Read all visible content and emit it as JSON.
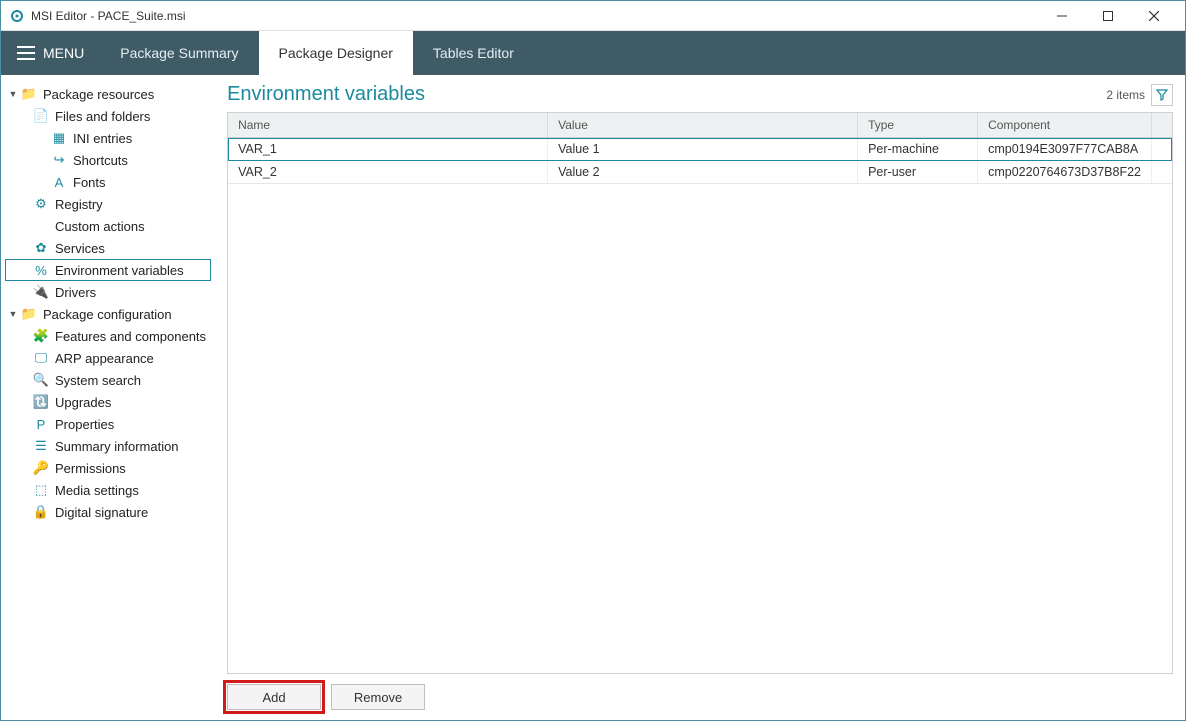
{
  "titlebar": {
    "title": "MSI Editor - PACE_Suite.msi"
  },
  "menubar": {
    "menu_label": "MENU"
  },
  "tabs": [
    {
      "label": "Package Summary",
      "active": false
    },
    {
      "label": "Package Designer",
      "active": true
    },
    {
      "label": "Tables Editor",
      "active": false
    }
  ],
  "sidebar": [
    {
      "label": "Package resources",
      "indent": 0,
      "toggle": "▼",
      "icon": "folder",
      "selected": false
    },
    {
      "label": "Files and folders",
      "indent": 1,
      "icon": "file",
      "selected": false
    },
    {
      "label": "INI entries",
      "indent": 2,
      "icon": "ini",
      "selected": false
    },
    {
      "label": "Shortcuts",
      "indent": 2,
      "icon": "shortcut",
      "selected": false
    },
    {
      "label": "Fonts",
      "indent": 2,
      "icon": "font",
      "selected": false
    },
    {
      "label": "Registry",
      "indent": 1,
      "icon": "registry",
      "selected": false
    },
    {
      "label": "Custom actions",
      "indent": 1,
      "icon": "code",
      "selected": false
    },
    {
      "label": "Services",
      "indent": 1,
      "icon": "gear",
      "selected": false
    },
    {
      "label": "Environment variables",
      "indent": 1,
      "icon": "percent",
      "selected": true
    },
    {
      "label": "Drivers",
      "indent": 1,
      "icon": "plug",
      "selected": false
    },
    {
      "label": "Package configuration",
      "indent": 0,
      "toggle": "▼",
      "icon": "folder",
      "selected": false
    },
    {
      "label": "Features and components",
      "indent": 1,
      "icon": "puzzle",
      "selected": false
    },
    {
      "label": "ARP appearance",
      "indent": 1,
      "icon": "monitor",
      "selected": false
    },
    {
      "label": "System search",
      "indent": 1,
      "icon": "search",
      "selected": false
    },
    {
      "label": "Upgrades",
      "indent": 1,
      "icon": "refresh",
      "selected": false
    },
    {
      "label": "Properties",
      "indent": 1,
      "icon": "prop",
      "selected": false
    },
    {
      "label": "Summary information",
      "indent": 1,
      "icon": "summary",
      "selected": false
    },
    {
      "label": "Permissions",
      "indent": 1,
      "icon": "key",
      "selected": false
    },
    {
      "label": "Media settings",
      "indent": 1,
      "icon": "media",
      "selected": false
    },
    {
      "label": "Digital signature",
      "indent": 1,
      "icon": "lock",
      "selected": false
    }
  ],
  "main": {
    "title": "Environment variables",
    "item_count_label": "2 items",
    "columns": {
      "name": "Name",
      "value": "Value",
      "type": "Type",
      "component": "Component"
    },
    "rows": [
      {
        "name": "VAR_1",
        "value": "Value 1",
        "type": "Per-machine",
        "component": "cmp0194E3097F77CAB8A",
        "selected": true
      },
      {
        "name": "VAR_2",
        "value": "Value 2",
        "type": "Per-user",
        "component": "cmp0220764673D37B8F22",
        "selected": false
      }
    ],
    "buttons": {
      "add": "Add",
      "remove": "Remove"
    }
  },
  "icons": {
    "folder": "📁",
    "file": "📄",
    "ini": "▦",
    "shortcut": "↪",
    "font": "A",
    "registry": "⚙",
    "code": "</>",
    "gear": "✿",
    "percent": "%",
    "plug": "🔌",
    "puzzle": "🧩",
    "monitor": "🖵",
    "search": "🔍",
    "refresh": "🔃",
    "prop": "P",
    "summary": "☰",
    "key": "🔑",
    "media": "⬚",
    "lock": "🔒"
  }
}
